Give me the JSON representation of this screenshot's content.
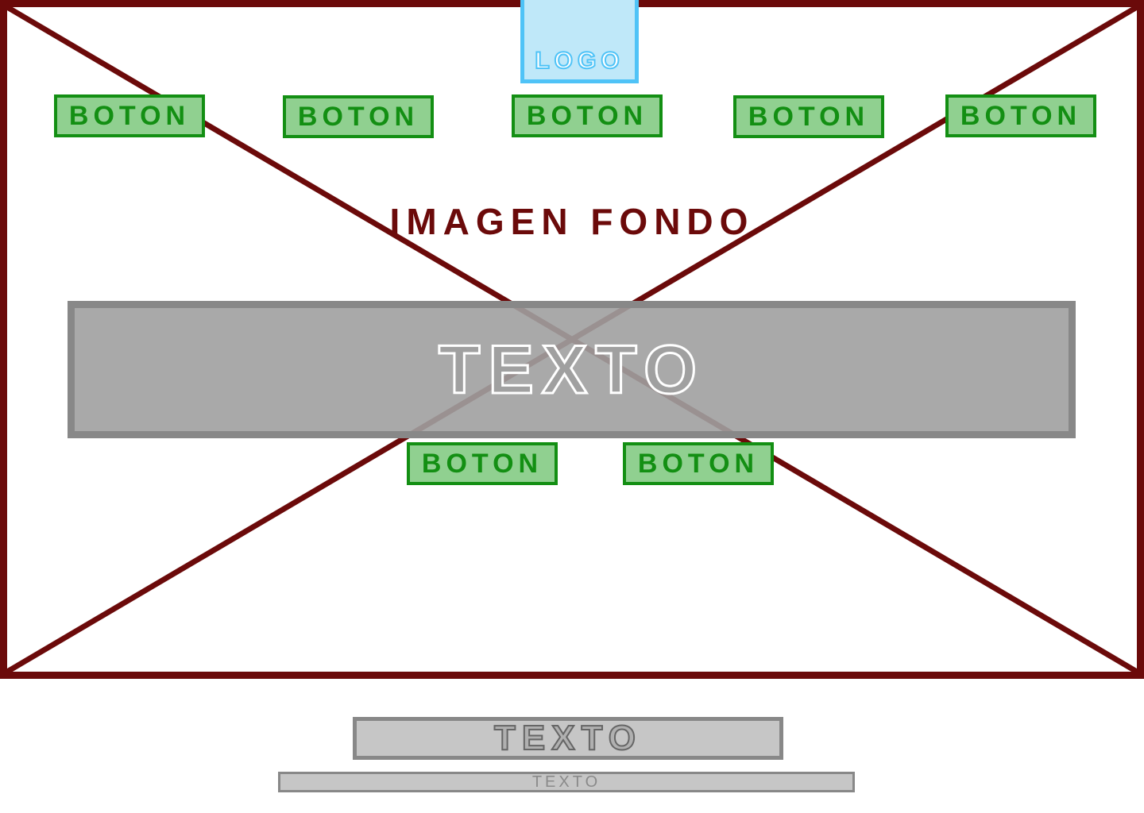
{
  "colors": {
    "frame": "#6b0a0a",
    "button_border": "#138f13",
    "button_fill": "#90d090",
    "logo_border": "#4fc3f7",
    "logo_fill": "#bfe8f9",
    "text_box_border": "#888888",
    "text_box_fill": "#a0a0a0"
  },
  "icons": {
    "background_placeholder": "image-placeholder-cross-icon"
  },
  "logo": {
    "label": "LOGO"
  },
  "nav": {
    "buttons": [
      {
        "label": "BOTON"
      },
      {
        "label": "BOTON"
      },
      {
        "label": "BOTON"
      },
      {
        "label": "BOTON"
      },
      {
        "label": "BOTON"
      }
    ]
  },
  "hero": {
    "background_label": "IMAGEN FONDO",
    "banner_text": "TEXTO",
    "cta_buttons": [
      {
        "label": "BOTON"
      },
      {
        "label": "BOTON"
      }
    ]
  },
  "footer": {
    "primary_text": "TEXTO",
    "secondary_text": "TEXTO"
  }
}
